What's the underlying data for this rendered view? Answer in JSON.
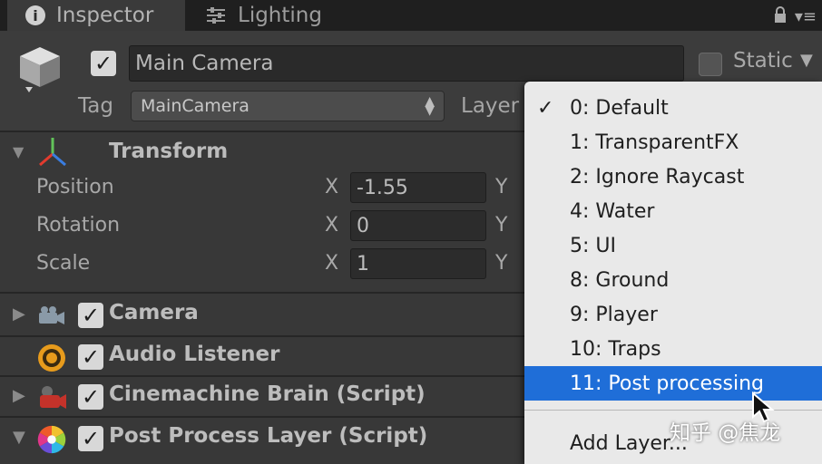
{
  "tabs": {
    "inspector": "Inspector",
    "lighting": "Lighting"
  },
  "gameobject": {
    "name": "Main Camera",
    "active": true,
    "static_label": "Static",
    "static_checked": false,
    "tag_label": "Tag",
    "tag_value": "MainCamera",
    "layer_label": "Layer"
  },
  "transform": {
    "title": "Transform",
    "position": {
      "label": "Position",
      "x_axis": "X",
      "x": "-1.55",
      "y_axis": "Y"
    },
    "rotation": {
      "label": "Rotation",
      "x_axis": "X",
      "x": "0",
      "y_axis": "Y"
    },
    "scale": {
      "label": "Scale",
      "x_axis": "X",
      "x": "1",
      "y_axis": "Y"
    }
  },
  "components": [
    {
      "name": "Camera",
      "icon": "camera-icon",
      "enabled": true
    },
    {
      "name": "Audio Listener",
      "icon": "audio-listener-icon",
      "enabled": true
    },
    {
      "name": "Cinemachine Brain (Script)",
      "icon": "cinemachine-icon",
      "enabled": true
    },
    {
      "name": "Post Process Layer (Script)",
      "icon": "post-process-icon",
      "enabled": true
    }
  ],
  "layer_menu": {
    "checkmark": "✓",
    "items": [
      "0: Default",
      "1: TransparentFX",
      "2: Ignore Raycast",
      "4: Water",
      "5: UI",
      "8: Ground",
      "9: Player",
      "10: Traps",
      "11: Post processing"
    ],
    "checked_item": "0: Default",
    "highlighted_item": "11: Post processing",
    "add_layer": "Add Layer..."
  },
  "watermark": "知乎 @焦龙",
  "colors": {
    "menu_highlight": "#1f6ed8",
    "panel_bg": "#383838",
    "menu_bg": "#e9e9e9"
  }
}
